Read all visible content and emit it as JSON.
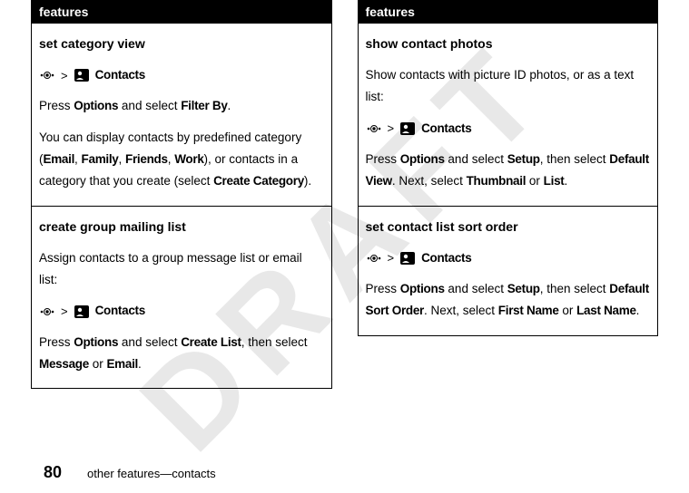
{
  "watermark": "DRAFT",
  "left": {
    "header": "features",
    "sections": [
      {
        "title": "set category view",
        "nav_label": "Contacts",
        "line1a": "Press ",
        "line1b": "Options",
        "line1c": " and select ",
        "line1d": "Filter By",
        "line1e": ".",
        "line2a": "You can display contacts by predefined category (",
        "line2b": "Email",
        "line2c": ", ",
        "line2d": "Family",
        "line2e": ", ",
        "line2f": "Friends",
        "line2g": ", ",
        "line2h": "Work",
        "line2i": "), or contacts in a category that you create (select ",
        "line2j": "Create Category",
        "line2k": ")."
      },
      {
        "title": "create group mailing list",
        "intro": "Assign contacts to a group message list or email list:",
        "nav_label": "Contacts",
        "line1a": "Press ",
        "line1b": "Options",
        "line1c": " and select ",
        "line1d": "Create List",
        "line1e": ", then select ",
        "line1f": "Message",
        "line1g": " or ",
        "line1h": "Email",
        "line1i": "."
      }
    ]
  },
  "right": {
    "header": "features",
    "sections": [
      {
        "title": "show contact photos",
        "intro": "Show contacts with picture ID photos, or as a text list:",
        "nav_label": "Contacts",
        "line1a": "Press ",
        "line1b": "Options",
        "line1c": " and select ",
        "line1d": "Setup",
        "line1e": ", then select ",
        "line1f": "Default View",
        "line1g": ". Next, select ",
        "line1h": "Thumbnail",
        "line1i": " or ",
        "line1j": "List",
        "line1k": "."
      },
      {
        "title": "set contact list sort order",
        "nav_label": "Contacts",
        "line1a": "Press ",
        "line1b": "Options",
        "line1c": " and select ",
        "line1d": "Setup",
        "line1e": ", then select ",
        "line1f": "Default Sort Order",
        "line1g": ". Next, select ",
        "line1h": "First Name",
        "line1i": " or ",
        "line1j": "Last Name",
        "line1k": "."
      }
    ]
  },
  "footer": {
    "page": "80",
    "text": "other features—contacts"
  }
}
